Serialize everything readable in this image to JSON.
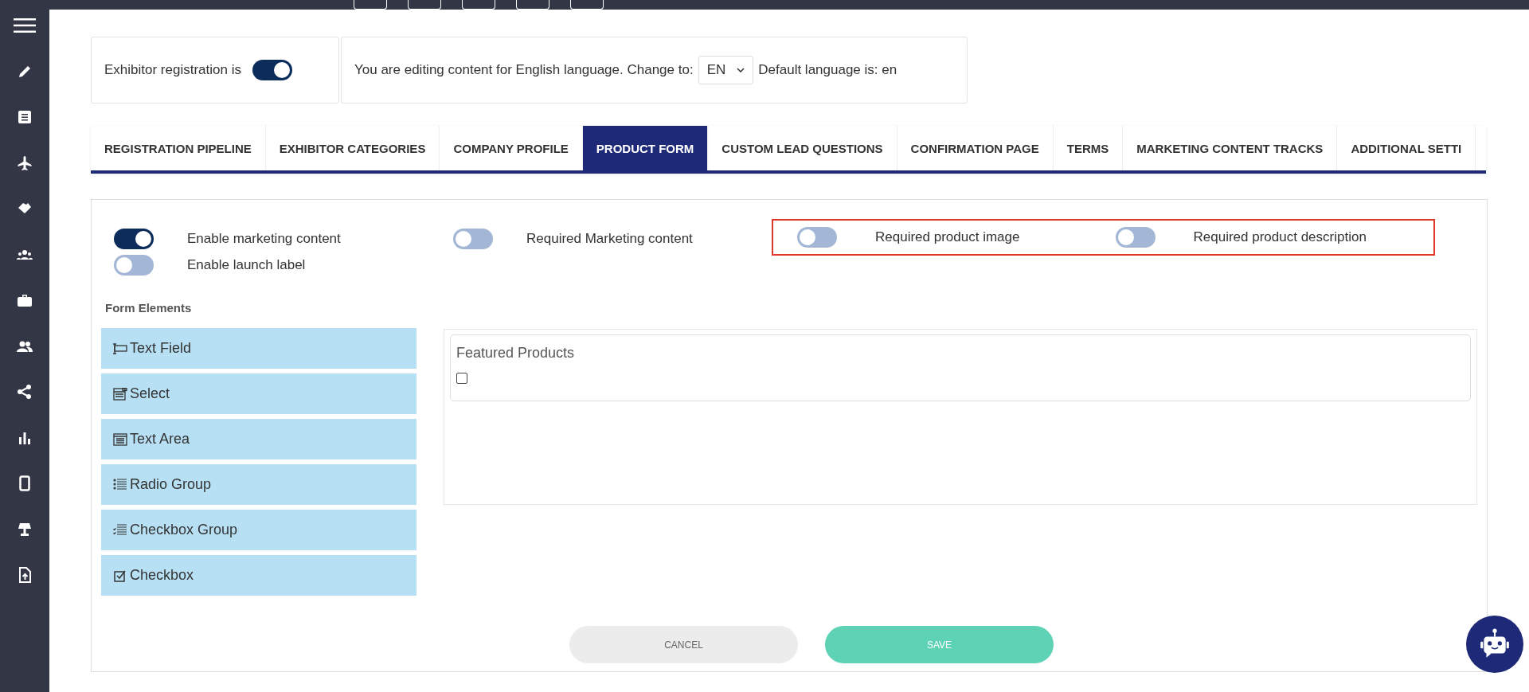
{
  "registration": {
    "label": "Exhibitor registration is",
    "on": true
  },
  "language": {
    "text": "You are editing content for English language. Change to:",
    "value": "EN",
    "default_text": "Default language is: en"
  },
  "tabs": [
    {
      "label": "REGISTRATION PIPELINE",
      "selected": false
    },
    {
      "label": "EXHIBITOR CATEGORIES",
      "selected": false
    },
    {
      "label": "COMPANY PROFILE",
      "selected": false
    },
    {
      "label": "PRODUCT FORM",
      "selected": true
    },
    {
      "label": "CUSTOM LEAD QUESTIONS",
      "selected": false
    },
    {
      "label": "CONFIRMATION PAGE",
      "selected": false
    },
    {
      "label": "TERMS",
      "selected": false
    },
    {
      "label": "MARKETING CONTENT TRACKS",
      "selected": false
    },
    {
      "label": "ADDITIONAL SETTI",
      "selected": false
    }
  ],
  "toggle_columns": [
    [
      {
        "label": "Enable marketing content",
        "on": true
      },
      {
        "label": "Enable launch label",
        "on": false
      }
    ],
    [
      {
        "label": "Required Marketing content",
        "on": false
      }
    ]
  ],
  "highlighted_toggles": [
    {
      "label": "Required product image",
      "on": false
    },
    {
      "label": "Required product description",
      "on": false
    }
  ],
  "form_elements": {
    "title": "Form Elements",
    "items": [
      {
        "kind": "textfield",
        "label": "Text Field"
      },
      {
        "kind": "select",
        "label": "Select"
      },
      {
        "kind": "textarea",
        "label": "Text Area"
      },
      {
        "kind": "radio",
        "label": "Radio Group"
      },
      {
        "kind": "checkgroup",
        "label": "Checkbox Group"
      },
      {
        "kind": "checkbox",
        "label": "Checkbox"
      }
    ]
  },
  "form_preview": {
    "fields": [
      {
        "label": "Featured Products",
        "checked": false
      }
    ]
  },
  "buttons": {
    "cancel": "CANCEL",
    "save": "SAVE"
  }
}
